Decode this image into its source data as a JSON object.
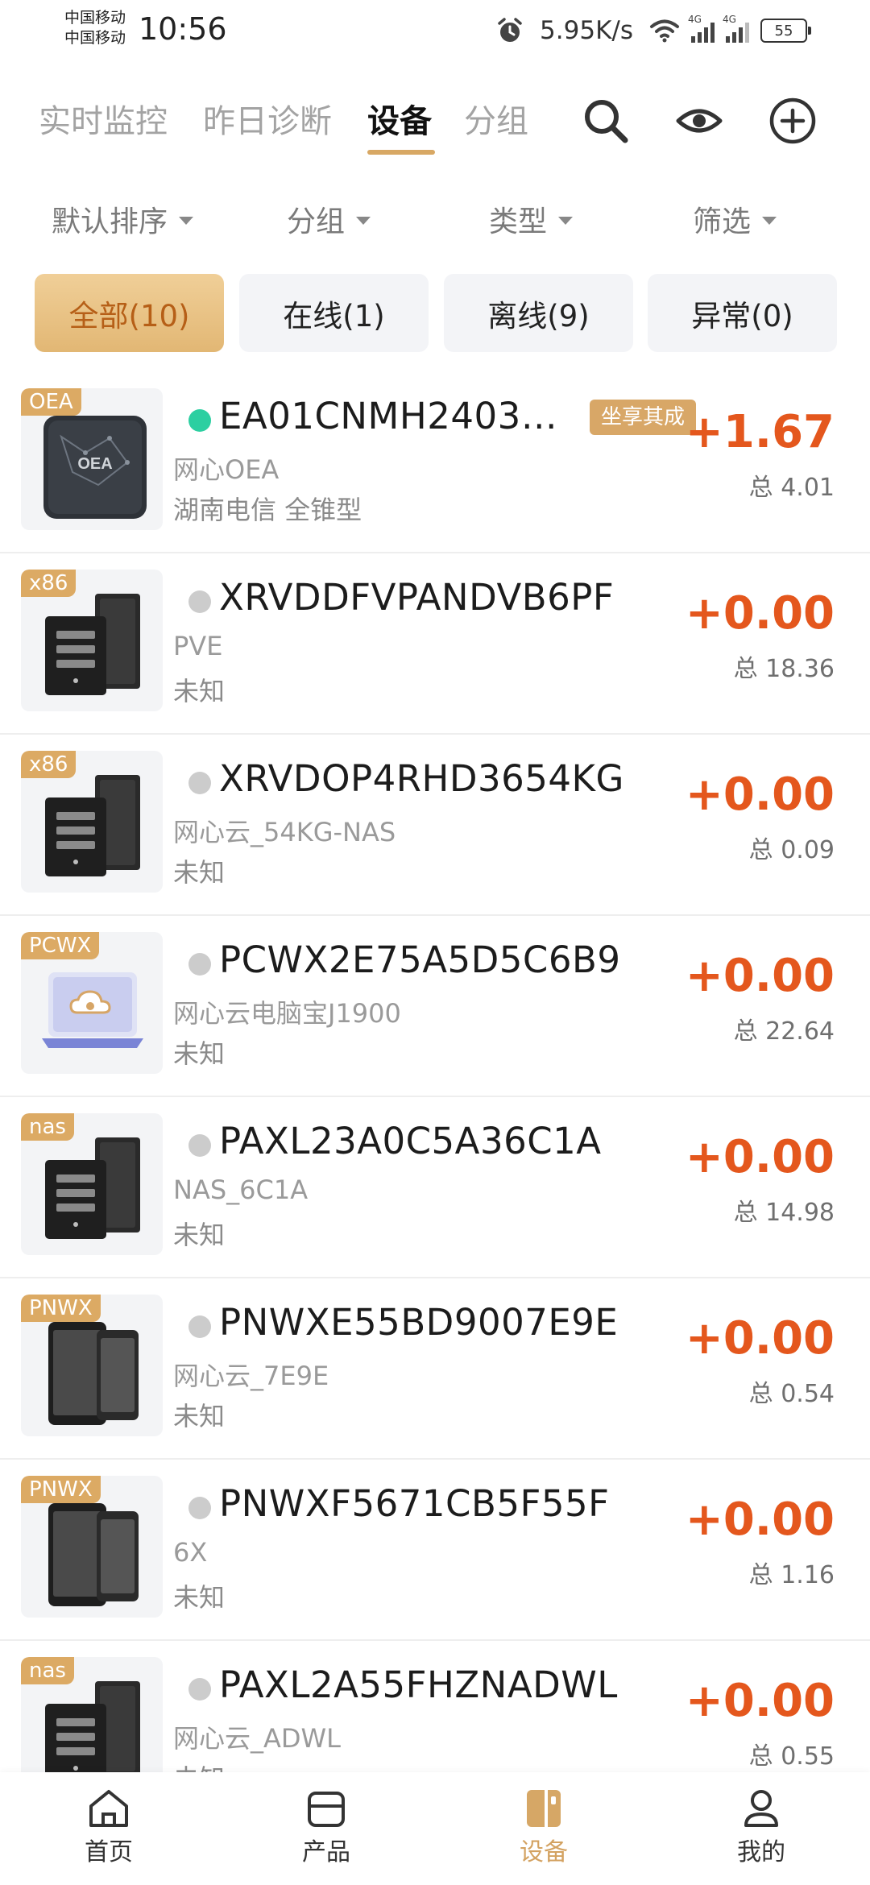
{
  "status_bar": {
    "carrier_1": "中国移动",
    "carrier_2": "中国移动",
    "time": "10:56",
    "net_speed": "5.95K/s",
    "signal_tag_1": "4G",
    "signal_tag_2": "4G",
    "battery": "55"
  },
  "tabs": [
    {
      "label": "实时监控"
    },
    {
      "label": "昨日诊断"
    },
    {
      "label": "设备"
    },
    {
      "label": "分组"
    }
  ],
  "active_tab": "设备",
  "header_icons": [
    "search-icon",
    "eye-icon",
    "add-circle-icon"
  ],
  "filters": [
    {
      "label": "默认排序"
    },
    {
      "label": "分组"
    },
    {
      "label": "类型"
    },
    {
      "label": "筛选"
    }
  ],
  "chips": [
    {
      "label": "全部(10)"
    },
    {
      "label": "在线(1)"
    },
    {
      "label": "离线(9)"
    },
    {
      "label": "异常(0)"
    }
  ],
  "devices": [
    {
      "badge": "OEA",
      "id": "EA01CNMH2403…",
      "model": "网心OEA",
      "location": "湖南电信  全锥型",
      "earnings": "+1.67",
      "total": "总 4.01",
      "promo": "坐享其成",
      "online": true,
      "image": "oea-box"
    },
    {
      "badge": "x86",
      "id": "XRVDDFVPANDVB6PF",
      "model": "PVE",
      "location": "未知",
      "earnings": "+0.00",
      "total": "总 18.36",
      "online": false,
      "image": "server"
    },
    {
      "badge": "x86",
      "id": "XRVDOP4RHD3654KG",
      "model": "网心云_54KG-NAS",
      "location": "未知",
      "earnings": "+0.00",
      "total": "总 0.09",
      "online": false,
      "image": "server"
    },
    {
      "badge": "PCWX",
      "id": "PCWX2E75A5D5C6B9",
      "model": "网心云电脑宝J1900",
      "location": "未知",
      "earnings": "+0.00",
      "total": "总 22.64",
      "online": false,
      "image": "laptop-cloud"
    },
    {
      "badge": "nas",
      "id": "PAXL23A0C5A36C1A",
      "model": "NAS_6C1A",
      "location": "未知",
      "earnings": "+0.00",
      "total": "总 14.98",
      "online": false,
      "image": "server"
    },
    {
      "badge": "PNWX",
      "id": "PNWXE55BD9007E9E",
      "model": "网心云_7E9E",
      "location": "未知",
      "earnings": "+0.00",
      "total": "总 0.54",
      "online": false,
      "image": "phones"
    },
    {
      "badge": "PNWX",
      "id": "PNWXF5671CB5F55F",
      "model": "6X",
      "location": "未知",
      "earnings": "+0.00",
      "total": "总 1.16",
      "online": false,
      "image": "phones"
    },
    {
      "badge": "nas",
      "id": "PAXL2A55FHZNADWL",
      "model": "网心云_ADWL",
      "location": "未知",
      "earnings": "+0.00",
      "total": "总 0.55",
      "online": false,
      "image": "server"
    }
  ],
  "bottom_nav": [
    {
      "label": "首页",
      "icon": "home-icon"
    },
    {
      "label": "产品",
      "icon": "box-icon"
    },
    {
      "label": "设备",
      "icon": "device-icon"
    },
    {
      "label": "我的",
      "icon": "profile-icon"
    }
  ],
  "active_nav": "设备",
  "colors": {
    "accent_gold": "#d8a864",
    "earnings_orange": "#e4571d",
    "online_green": "#2ccfa1",
    "offline_gray": "#cccccc"
  }
}
